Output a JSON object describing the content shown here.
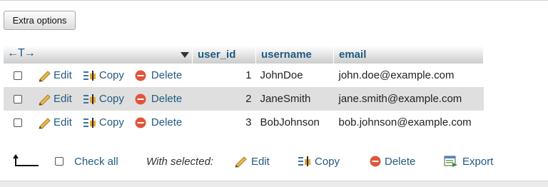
{
  "extra_options_label": "Extra options",
  "table": {
    "arrows_glyph": "←T→",
    "columns": [
      "user_id",
      "username",
      "email"
    ],
    "action_labels": {
      "edit": "Edit",
      "copy": "Copy",
      "delete": "Delete"
    },
    "rows": [
      {
        "user_id": "1",
        "username": "JohnDoe",
        "email": "john.doe@example.com"
      },
      {
        "user_id": "2",
        "username": "JaneSmith",
        "email": "jane.smith@example.com"
      },
      {
        "user_id": "3",
        "username": "BobJohnson",
        "email": "bob.johnson@example.com"
      }
    ]
  },
  "footer": {
    "check_all_label": "Check all",
    "with_selected_label": "With selected:",
    "edit_label": "Edit",
    "copy_label": "Copy",
    "delete_label": "Delete",
    "export_label": "Export"
  },
  "icons": {
    "edit": "pencil-icon",
    "copy": "copy-icon",
    "delete": "delete-icon",
    "export": "export-icon",
    "arrow": "arrow-up-left-icon",
    "sort": "sort-triangle-icon"
  },
  "colors": {
    "link": "#235a81",
    "header_gradient_top": "#ffffff",
    "header_gradient_bottom": "#cccccc",
    "row_alt": "#dfdfdf",
    "delete_red": "#e0553a"
  }
}
